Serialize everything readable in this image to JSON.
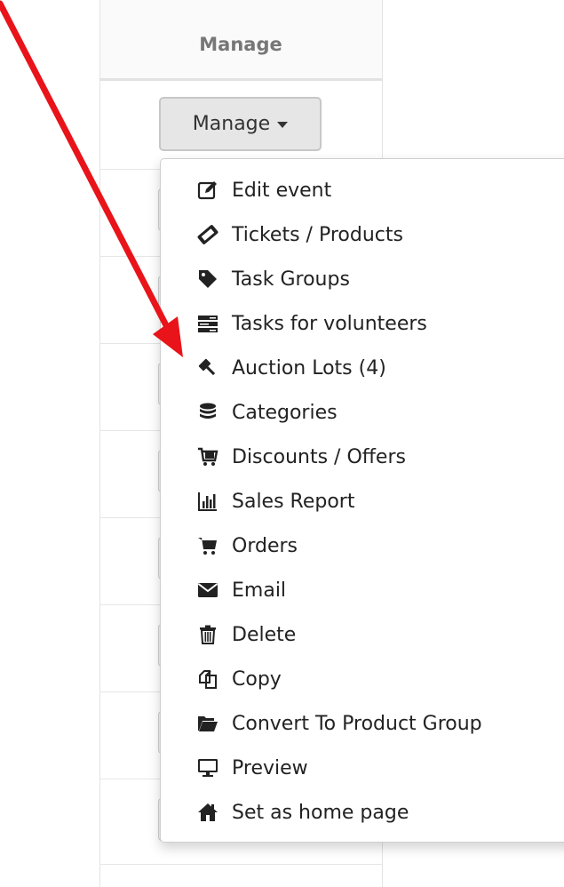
{
  "table": {
    "header_title": "Manage"
  },
  "manage_button": {
    "label": "Manage"
  },
  "menu": {
    "items": [
      {
        "label": "Edit event",
        "icon": "edit-icon"
      },
      {
        "label": "Tickets / Products",
        "icon": "ticket-icon"
      },
      {
        "label": "Task Groups",
        "icon": "tag-icon"
      },
      {
        "label": "Tasks for volunteers",
        "icon": "tasks-icon"
      },
      {
        "label": "Auction Lots (4)",
        "icon": "gavel-icon"
      },
      {
        "label": "Categories",
        "icon": "database-icon"
      },
      {
        "label": "Discounts / Offers",
        "icon": "cart-discount-icon"
      },
      {
        "label": "Sales Report",
        "icon": "chart-icon"
      },
      {
        "label": "Orders",
        "icon": "cart-icon"
      },
      {
        "label": "Email",
        "icon": "envelope-icon"
      },
      {
        "label": "Delete",
        "icon": "trash-icon"
      },
      {
        "label": "Copy",
        "icon": "copy-icon"
      },
      {
        "label": "Convert To Product Group",
        "icon": "folder-open-icon"
      },
      {
        "label": "Preview",
        "icon": "monitor-icon"
      },
      {
        "label": "Set as home page",
        "icon": "home-icon"
      }
    ]
  },
  "colors": {
    "arrow": "#e8141a",
    "button_bg": "#e6e6e6",
    "menu_border": "#cfcfcf",
    "icon": "#222222"
  }
}
